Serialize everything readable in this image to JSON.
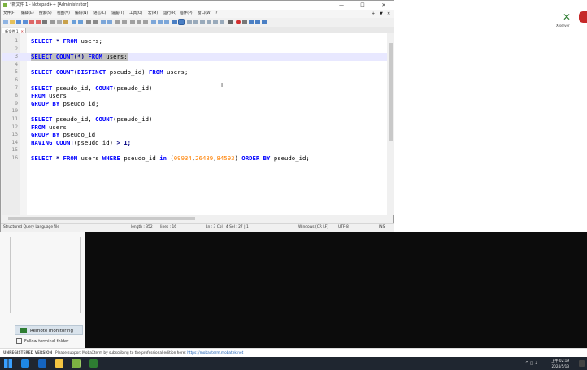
{
  "window": {
    "title": "*新文件 1 - Notepad++ [Administrator]",
    "controls": {
      "minimize": "—",
      "maximize": "☐",
      "close": "✕"
    }
  },
  "menu": {
    "items": [
      "文件(F)",
      "编辑(E)",
      "搜索(S)",
      "视图(V)",
      "编码(N)",
      "语言(L)",
      "设置(T)",
      "工具(O)",
      "宏(M)",
      "运行(R)",
      "插件(P)",
      "窗口(W)",
      "?"
    ],
    "right": [
      "+",
      "▼",
      "✕"
    ]
  },
  "tab": {
    "label": "新文件 1",
    "close": "✕"
  },
  "editor": {
    "lines": [
      {
        "n": "1",
        "tokens": [
          {
            "t": "SELECT",
            "c": "kw"
          },
          {
            "t": " * ",
            "c": "op"
          },
          {
            "t": "FROM",
            "c": "kw"
          },
          {
            "t": " users;",
            "c": "id"
          }
        ]
      },
      {
        "n": "2",
        "tokens": []
      },
      {
        "n": "3",
        "tokens": [
          {
            "t": "SELECT",
            "c": "kw"
          },
          {
            "t": " ",
            "c": "id"
          },
          {
            "t": "COUNT",
            "c": "kw"
          },
          {
            "t": "(*)",
            "c": "op"
          },
          {
            "t": " ",
            "c": "id"
          },
          {
            "t": "FROM",
            "c": "kw"
          },
          {
            "t": " users;",
            "c": "id"
          }
        ],
        "highlight": true
      },
      {
        "n": "4",
        "tokens": []
      },
      {
        "n": "5",
        "tokens": [
          {
            "t": "SELECT",
            "c": "kw"
          },
          {
            "t": " ",
            "c": "id"
          },
          {
            "t": "COUNT",
            "c": "kw"
          },
          {
            "t": "(",
            "c": "op"
          },
          {
            "t": "DISTINCT",
            "c": "kw"
          },
          {
            "t": " pseudo_id) ",
            "c": "id"
          },
          {
            "t": "FROM",
            "c": "kw"
          },
          {
            "t": " users;",
            "c": "id"
          }
        ]
      },
      {
        "n": "6",
        "tokens": []
      },
      {
        "n": "7",
        "tokens": [
          {
            "t": "SELECT",
            "c": "kw"
          },
          {
            "t": " pseudo_id, ",
            "c": "id"
          },
          {
            "t": "COUNT",
            "c": "kw"
          },
          {
            "t": "(pseudo_id)",
            "c": "id"
          }
        ]
      },
      {
        "n": "8",
        "tokens": [
          {
            "t": "FROM",
            "c": "kw"
          },
          {
            "t": " users",
            "c": "id"
          }
        ]
      },
      {
        "n": "9",
        "tokens": [
          {
            "t": "GROUP BY",
            "c": "kw"
          },
          {
            "t": " pseudo_id;",
            "c": "id"
          }
        ]
      },
      {
        "n": "10",
        "tokens": []
      },
      {
        "n": "11",
        "tokens": [
          {
            "t": "SELECT",
            "c": "kw"
          },
          {
            "t": " pseudo_id, ",
            "c": "id"
          },
          {
            "t": "COUNT",
            "c": "kw"
          },
          {
            "t": "(pseudo_id)",
            "c": "id"
          }
        ]
      },
      {
        "n": "12",
        "tokens": [
          {
            "t": "FROM",
            "c": "kw"
          },
          {
            "t": " users",
            "c": "id"
          }
        ]
      },
      {
        "n": "13",
        "tokens": [
          {
            "t": "GROUP BY",
            "c": "kw"
          },
          {
            "t": " pseudo_id",
            "c": "id"
          }
        ]
      },
      {
        "n": "14",
        "tokens": [
          {
            "t": "HAVING",
            "c": "kw"
          },
          {
            "t": " ",
            "c": "id"
          },
          {
            "t": "COUNT",
            "c": "kw"
          },
          {
            "t": "(pseudo_id) ",
            "c": "id"
          },
          {
            "t": "> 1;",
            "c": "op"
          }
        ]
      },
      {
        "n": "15",
        "tokens": []
      },
      {
        "n": "16",
        "tokens": [
          {
            "t": "SELECT",
            "c": "kw"
          },
          {
            "t": " * ",
            "c": "op"
          },
          {
            "t": "FROM",
            "c": "kw"
          },
          {
            "t": " users ",
            "c": "id"
          },
          {
            "t": "WHERE",
            "c": "kw"
          },
          {
            "t": " pseudo_id ",
            "c": "id"
          },
          {
            "t": "in",
            "c": "kw"
          },
          {
            "t": " (",
            "c": "id"
          },
          {
            "t": "09934",
            "c": "nm"
          },
          {
            "t": ",",
            "c": "id"
          },
          {
            "t": "26489",
            "c": "nm"
          },
          {
            "t": ",",
            "c": "id"
          },
          {
            "t": "84593",
            "c": "nm"
          },
          {
            "t": ") ",
            "c": "id"
          },
          {
            "t": "ORDER BY",
            "c": "kw"
          },
          {
            "t": " pseudo_id;",
            "c": "id"
          }
        ]
      }
    ]
  },
  "status": {
    "language": "Structured Query Language file",
    "length": "length : 352",
    "lines": "lines : 16",
    "position": "Ln : 3   Col : 4   Sel : 27 | 1",
    "eol": "Windows (CR LF)",
    "encoding": "UTF-8",
    "mode": "INS"
  },
  "side_panel": {
    "remote_button": "Remote monitoring",
    "follow_label": "Follow terminal folder"
  },
  "desktop": {
    "icon1_label": "X-server"
  },
  "banner": {
    "unregistered": "UNREGISTERED VERSION",
    "message": "Please support MobaXterm by subscribing to the professional edition here:",
    "link": "https://mobaxterm.mobatek.net"
  },
  "taskbar": {
    "time": "上午 02:19",
    "date": "2024/5/13",
    "tray": "^  ◫  ♪"
  },
  "colors": {
    "keyword": "#0000ff",
    "number": "#ff8000",
    "terminal": "#0c0c0c",
    "taskbar": "#1f2630"
  }
}
